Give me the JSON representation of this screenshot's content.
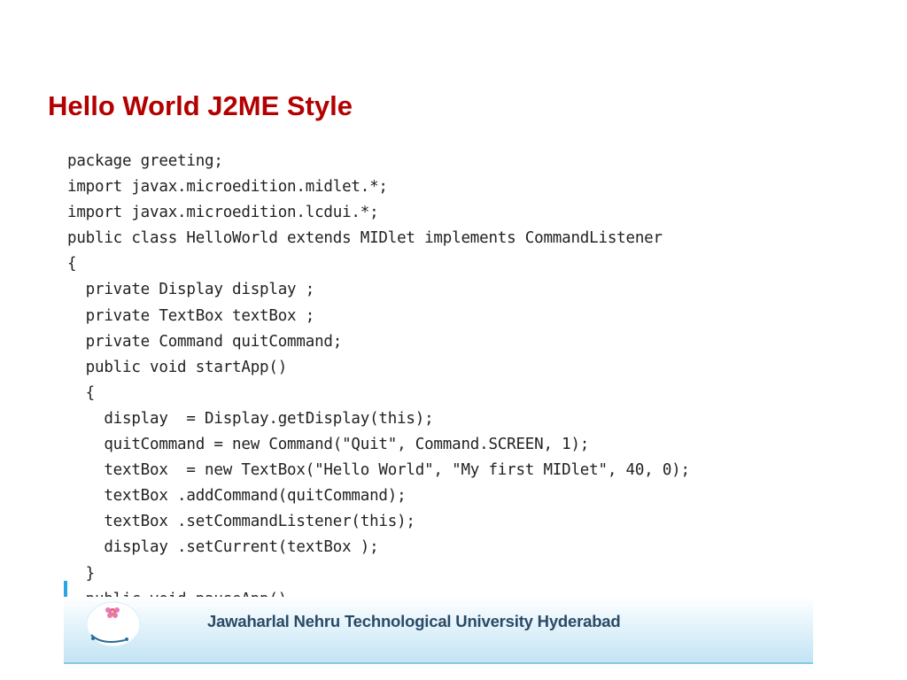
{
  "slide": {
    "title": "Hello World J2ME Style",
    "code_lines": [
      "package greeting;",
      "import javax.microedition.midlet.*;",
      "import javax.microedition.lcdui.*;",
      "public class HelloWorld extends MIDlet implements CommandListener",
      "{",
      "  private Display display ;",
      "  private TextBox textBox ;",
      "  private Command quitCommand;",
      "  public void startApp()",
      "  {",
      "    display  = Display.getDisplay(this);",
      "    quitCommand = new Command(\"Quit\", Command.SCREEN, 1);",
      "    textBox  = new TextBox(\"Hello World\", \"My first MIDlet\", 40, 0);",
      "    textBox .addCommand(quitCommand);",
      "    textBox .setCommandListener(this);",
      "    display .setCurrent(textBox );",
      "  }",
      "  public void pauseApp()"
    ]
  },
  "footer": {
    "university": "Jawaharlal Nehru Technological University Hyderabad",
    "logo_icon": "university-emblem-icon"
  },
  "colors": {
    "title": "#b30000",
    "code_text": "#222222",
    "footer_text": "#2a4a66",
    "footer_accent": "#29a7e0",
    "footer_bg": "#c3e4f4"
  }
}
